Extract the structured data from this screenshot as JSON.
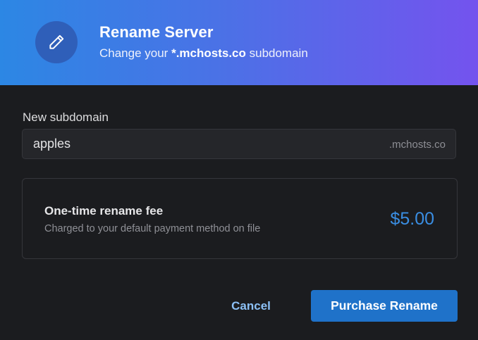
{
  "header": {
    "title": "Rename Server",
    "subtitle_prefix": "Change your ",
    "subtitle_domain": "*.mchosts.co",
    "subtitle_suffix": " subdomain",
    "icon": "pencil-icon"
  },
  "form": {
    "label": "New subdomain",
    "value": "apples",
    "suffix": ".mchosts.co"
  },
  "fee": {
    "title": "One-time rename fee",
    "description": "Charged to your default payment method on file",
    "amount": "$5.00"
  },
  "actions": {
    "cancel_label": "Cancel",
    "purchase_label": "Purchase Rename"
  },
  "colors": {
    "gradient_start": "#2c87e4",
    "gradient_end": "#7453ee",
    "accent": "#1f72c9",
    "price": "#3a8ee3",
    "background": "#1b1c1f"
  }
}
